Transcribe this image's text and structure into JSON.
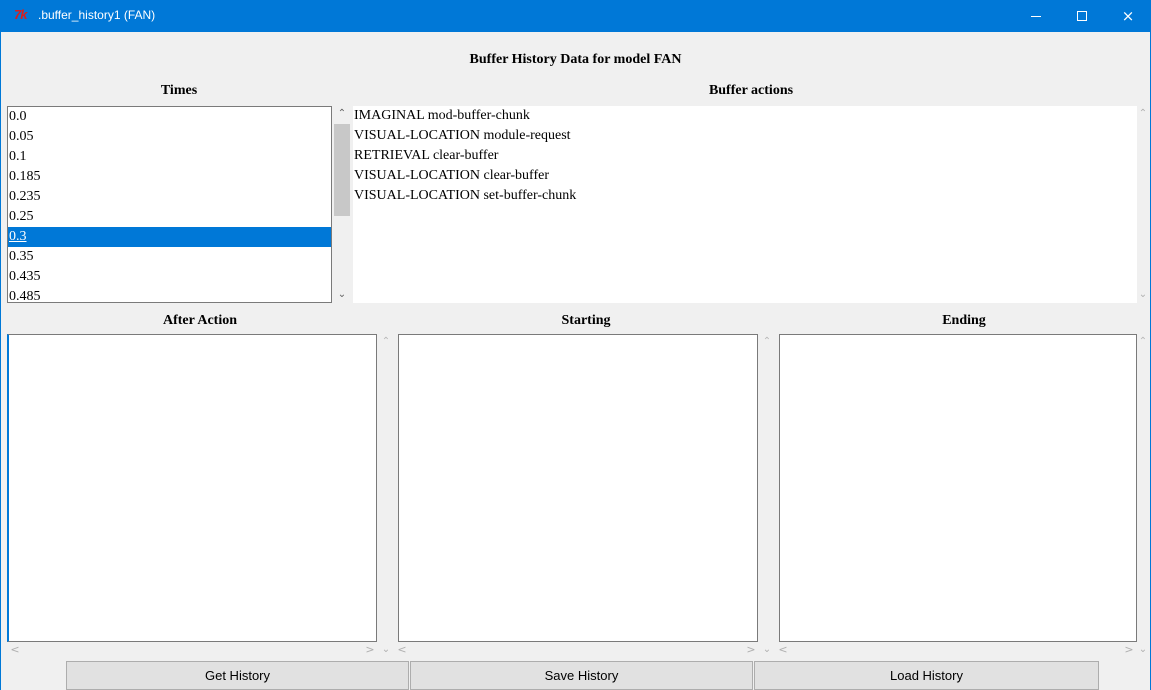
{
  "window": {
    "app_icon": "7k",
    "title": ".buffer_history1 (FAN)",
    "minimize_icon": "minimize-icon",
    "maximize_icon": "maximize-icon",
    "close_icon": "×",
    "accent_color": "#0078d7"
  },
  "main": {
    "title": "Buffer History Data for model FAN"
  },
  "times": {
    "heading": "Times",
    "items": [
      "0.0",
      "0.05",
      "0.1",
      "0.185",
      "0.235",
      "0.25",
      "0.3",
      "0.35",
      "0.435",
      "0.485"
    ],
    "selected": "0.3"
  },
  "actions": {
    "heading": "Buffer actions",
    "items": [
      "IMAGINAL mod-buffer-chunk",
      "VISUAL-LOCATION module-request",
      "RETRIEVAL clear-buffer",
      "VISUAL-LOCATION clear-buffer",
      "VISUAL-LOCATION set-buffer-chunk"
    ]
  },
  "panes": {
    "after_action": "After Action",
    "starting": "Starting",
    "ending": "Ending"
  },
  "buttons": {
    "get_history": "Get History",
    "save_history": "Save History",
    "load_history": "Load History"
  }
}
